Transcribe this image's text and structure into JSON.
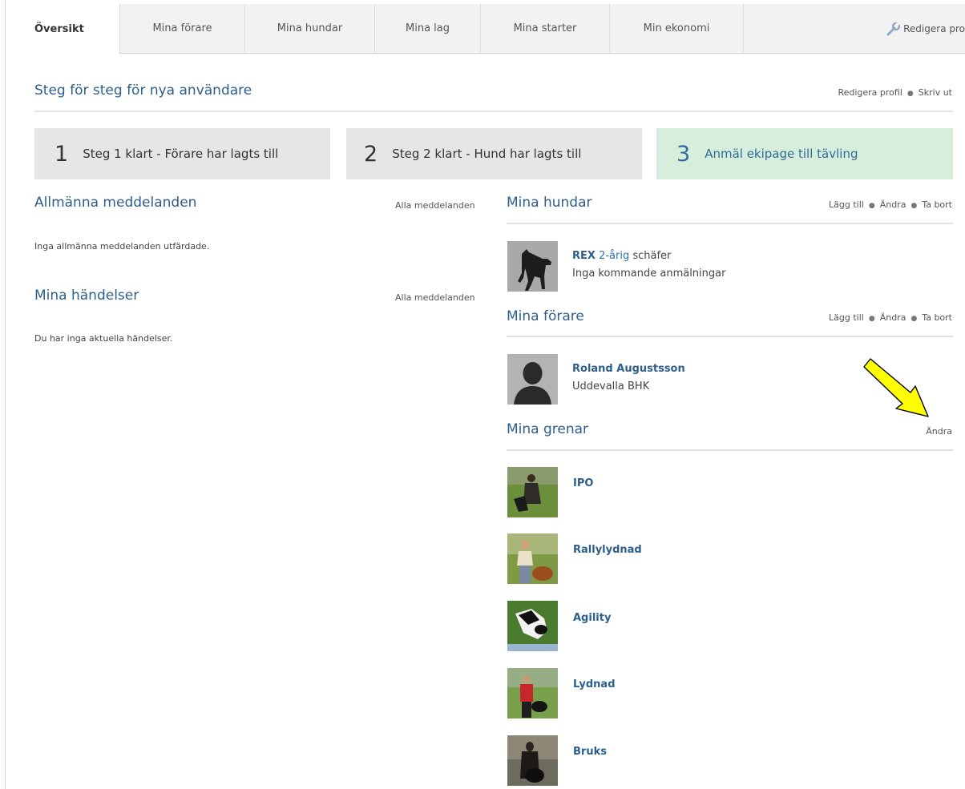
{
  "tabs": [
    {
      "label": "Översikt"
    },
    {
      "label": "Mina förare"
    },
    {
      "label": "Mina hundar"
    },
    {
      "label": "Mina lag"
    },
    {
      "label": "Mina starter"
    },
    {
      "label": "Min ekonomi"
    }
  ],
  "edit_profile_tab": "Redigera pro",
  "header": {
    "title": "Steg för steg för nya användare",
    "edit_profile": "Redigera profil",
    "print": "Skriv ut"
  },
  "steps": [
    {
      "num": "1",
      "label": "Steg 1 klart - Förare har lagts till"
    },
    {
      "num": "2",
      "label": "Steg 2 klart - Hund har lagts till"
    },
    {
      "num": "3",
      "label": "Anmäl ekipage till tävling"
    }
  ],
  "general_messages": {
    "title": "Allmänna meddelanden",
    "link": "Alla meddelanden",
    "empty": "Inga allmänna meddelanden utfärdade."
  },
  "my_events": {
    "title": "Mina händelser",
    "link": "Alla meddelanden",
    "empty": "Du har inga aktuella händelser."
  },
  "my_dogs": {
    "title": "Mina hundar",
    "add": "Lägg till",
    "edit": "Ändra",
    "remove": "Ta bort",
    "dog": {
      "name": "REX",
      "age": "2-årig",
      "breed": "schäfer",
      "status": "Inga kommande anmälningar"
    }
  },
  "my_handlers": {
    "title": "Mina förare",
    "add": "Lägg till",
    "edit": "Ändra",
    "remove": "Ta bort",
    "handler": {
      "name": "Roland Augustsson",
      "club": "Uddevalla BHK"
    }
  },
  "my_branches": {
    "title": "Mina grenar",
    "edit": "Ändra",
    "items": [
      {
        "name": "IPO"
      },
      {
        "name": "Rallylydnad"
      },
      {
        "name": "Agility"
      },
      {
        "name": "Lydnad"
      },
      {
        "name": "Bruks"
      }
    ]
  },
  "colors": {
    "accent": "#2c5f8c",
    "step_done": "#e6e6e6",
    "step_next": "#d7eedd",
    "arrow": "#ffff00"
  }
}
